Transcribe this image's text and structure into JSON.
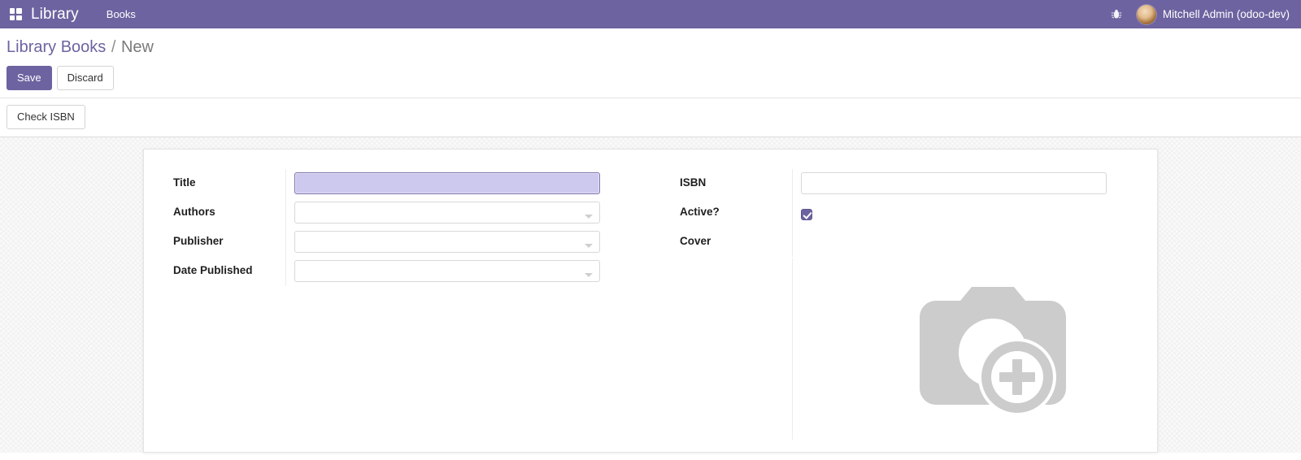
{
  "navbar": {
    "apps_icon": "apps-grid-icon",
    "brand": "Library",
    "menus": [
      {
        "label": "Books"
      }
    ],
    "debug_icon": "bug-icon",
    "avatar_icon": "user-avatar",
    "user_name": "Mitchell Admin (odoo-dev)",
    "background_color": "#6d63a0"
  },
  "control_panel": {
    "breadcrumb": {
      "parent": "Library Books",
      "separator": "/",
      "current": "New"
    },
    "save_label": "Save",
    "discard_label": "Discard"
  },
  "statusbar": {
    "buttons": [
      {
        "label": "Check ISBN"
      }
    ]
  },
  "form": {
    "left_group": [
      {
        "label": "Title",
        "type": "text",
        "value": "",
        "placeholder": "",
        "focused": true
      },
      {
        "label": "Authors",
        "type": "many2many",
        "value": "",
        "placeholder": "",
        "focused": false
      },
      {
        "label": "Publisher",
        "type": "many2one",
        "value": "",
        "placeholder": "",
        "focused": false
      },
      {
        "label": "Date Published",
        "type": "many2one",
        "value": "",
        "placeholder": "",
        "focused": false
      }
    ],
    "right_group": [
      {
        "label": "ISBN",
        "type": "text",
        "value": "",
        "placeholder": "",
        "focused": false
      },
      {
        "label": "Active?",
        "type": "boolean",
        "checked": true
      },
      {
        "label": "Cover",
        "type": "image",
        "placeholder_icon": "camera-add-placeholder-icon"
      }
    ]
  },
  "colors": {
    "brand_purple": "#6d63a0",
    "focus_field_bg": "#cdc9ee",
    "placeholder_gray": "#cccccc"
  }
}
